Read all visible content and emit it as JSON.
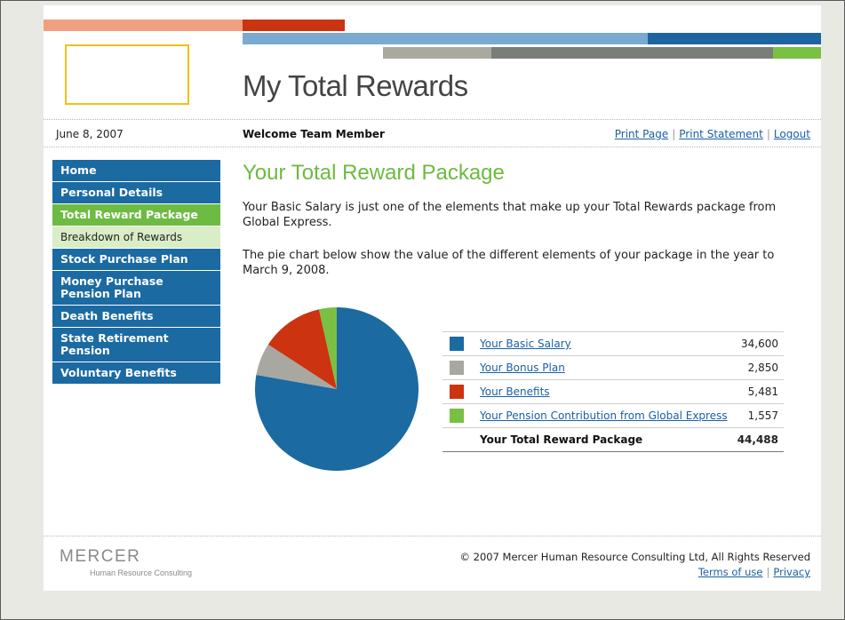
{
  "header": {
    "site_title": "My Total Rewards",
    "date": "June 8, 2007",
    "welcome": "Welcome Team Member",
    "links": [
      "Print Page",
      "Print Statement",
      "Logout"
    ],
    "separator": "|",
    "colors": {
      "salmon": "#f0a080",
      "red": "#cc3311",
      "lightblue": "#7aaad2",
      "darkblue": "#1e64a0",
      "lightgray": "#a9a9a0",
      "darkgray": "#7a7e78",
      "green": "#7ac043"
    }
  },
  "sidebar": {
    "items": [
      {
        "label": "Home",
        "state": "normal"
      },
      {
        "label": "Personal Details",
        "state": "normal"
      },
      {
        "label": "Total Reward Package",
        "state": "active"
      },
      {
        "label": "Breakdown of Rewards",
        "state": "sub"
      },
      {
        "label": "Stock Purchase Plan",
        "state": "normal"
      },
      {
        "label": "Money Purchase Pension Plan",
        "state": "normal"
      },
      {
        "label": "Death Benefits",
        "state": "normal"
      },
      {
        "label": "State Retirement Pension",
        "state": "normal"
      },
      {
        "label": "Voluntary Benefits",
        "state": "normal"
      }
    ]
  },
  "main": {
    "heading": "Your Total Reward Package",
    "para1": "Your Basic Salary is just one of the elements that make up your Total Rewards package from Global Express.",
    "para2": "The pie chart below show the value of the different elements of your package in the year to March 9, 2008.",
    "rewards": [
      {
        "label": "Your Basic Salary",
        "value": "34,600",
        "color": "#1b6aa2"
      },
      {
        "label": "Your Bonus Plan",
        "value": "2,850",
        "color": "#a8a8a0"
      },
      {
        "label": "Your Benefits",
        "value": "5,481",
        "color": "#cc3311"
      },
      {
        "label": "Your Pension Contribution from Global Express",
        "value": "1,557",
        "color": "#7ac043"
      }
    ],
    "total_label": "Your Total Reward Package",
    "total_value": "44,488"
  },
  "chart_data": {
    "type": "pie",
    "categories": [
      "Your Basic Salary",
      "Your Bonus Plan",
      "Your Benefits",
      "Your Pension Contribution from Global Express"
    ],
    "values": [
      34600,
      2850,
      5481,
      1557
    ],
    "colors": [
      "#1b6aa2",
      "#a8a8a0",
      "#cc3311",
      "#7ac043"
    ]
  },
  "footer": {
    "brand": "MERCER",
    "brand_sub": "Human Resource Consulting",
    "copyright": "© 2007 Mercer Human Resource Consulting Ltd, All Rights Reserved",
    "links": [
      "Terms of use",
      "Privacy"
    ]
  }
}
